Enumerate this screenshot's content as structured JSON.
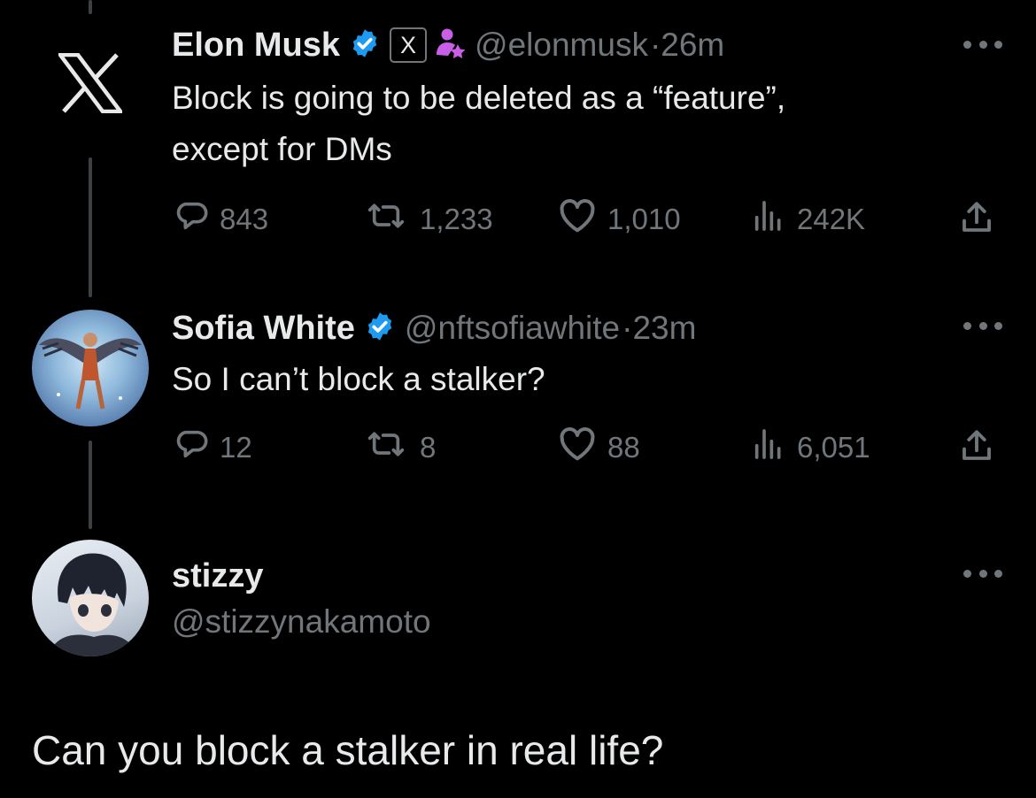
{
  "tweet1": {
    "display_name": "Elon Musk",
    "x_badge": "X",
    "handle": "@elonmusk",
    "time": "·26m",
    "text_line1": "Block is going to be deleted as a “feature”,",
    "text_line2": "except for DMs",
    "replies": "843",
    "reposts": "1,233",
    "likes": "1,010",
    "views": "242K"
  },
  "tweet2": {
    "display_name": "Sofia White",
    "handle": "@nftsofiawhite",
    "time": "·23m",
    "text": "So I can’t block a stalker?",
    "replies": "12",
    "reposts": "8",
    "likes": "88",
    "views": "6,051"
  },
  "tweet3": {
    "display_name": "stizzy",
    "handle": "@stizzynakamoto",
    "text": "Can you block a stalker in real life?"
  },
  "icons": {
    "logo": "x-logo-icon",
    "verified": "verified-badge-icon",
    "affiliate": "affiliate-person-star-icon",
    "reply": "reply-bubble-icon",
    "repost": "repost-icon",
    "like": "heart-icon",
    "views": "views-bars-icon",
    "share": "share-icon",
    "more": "more-dots-icon"
  },
  "colors": {
    "background": "#000000",
    "text": "#e7e9ea",
    "muted": "#71767b",
    "verified_blue": "#1d9bf0",
    "thread_line": "#3e4144",
    "affiliate_purple": "#c95fe6"
  }
}
